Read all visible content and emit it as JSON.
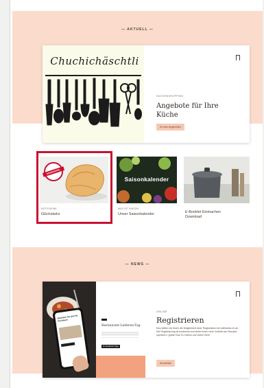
{
  "sections": {
    "current": "— AKTUELL —",
    "news": "— NEWS —"
  },
  "hero": {
    "logo_text": "Chuchichäschtli",
    "eyebrow": "KÜCHENSHOPPING",
    "title": "Angebote für Ihre Küche",
    "cta": "Zu den Angeboten"
  },
  "tiles": [
    {
      "label": "MOTIVSHINE",
      "title": "Glückskeks",
      "badge": "GEWINNSPIEL"
    },
    {
      "label": "WAS IST SAISON",
      "title": "Unser Saisonkalender",
      "overlay": "Saisonkalender"
    },
    {
      "label": "",
      "title": "E-Booklet Einmachen Download"
    }
  ],
  "news": {
    "eyebrow": "ONLINE",
    "title": "Registrieren",
    "body": "Neu bieten wir Ihnen die Möglichkeit einer Registration bei edelweiss.ch an. Die Registrierung ist kostenlos und bietet Ihnen viele Vorteile wie Rezepte speichern, gratis How-To-Videos und vieles mehr.",
    "cta": "Anmelden",
    "phone_headline": "Bestellen Sie jetzt Ihr Kochbuch",
    "card_title": "Restaurant-Lieferen-Tag",
    "card_button": "Zu Newsletter Page"
  },
  "colors": {
    "band": "#fbdccc",
    "accent": "#f6c8b4",
    "highlight": "#c9102f"
  }
}
